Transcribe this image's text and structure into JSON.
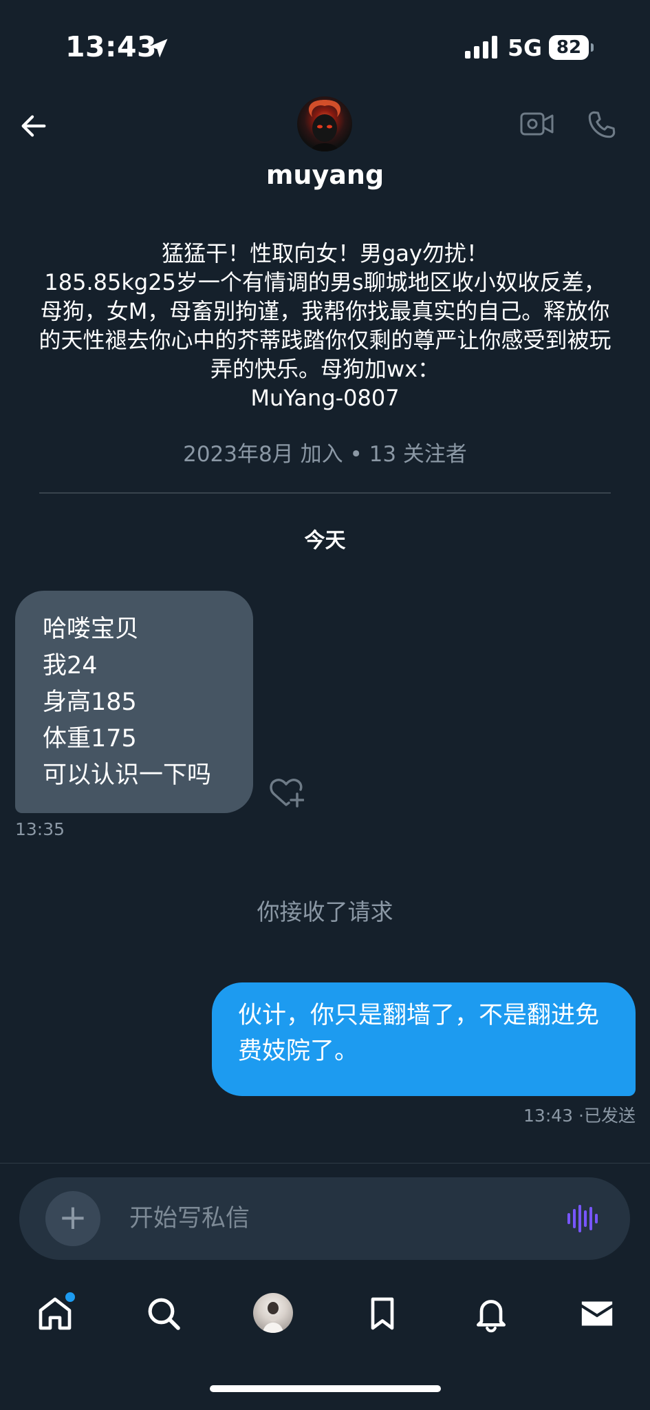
{
  "status_bar": {
    "time": "13:43",
    "network": "5G",
    "battery": "82"
  },
  "header": {
    "username": "muyang",
    "icons": [
      "back-arrow-icon",
      "video-call-icon",
      "phone-call-icon"
    ]
  },
  "profile": {
    "bio": "猛猛干！性取向女！男gay勿扰！\n185.85kg25岁一个有情调的男s聊城地区收小奴收反差，母狗，女M，母畜别拘谨，我帮你找最真实的自己。释放你的天性褪去你心中的芥蒂践踏你仅剩的尊严让你感受到被玩弄的快乐。母狗加wx：\nMuYang-0807",
    "joined": "2023年8月 加入",
    "separator": "•",
    "followers": "13 关注者"
  },
  "conversation": {
    "date_separator": "今天",
    "incoming": {
      "lines": [
        "哈喽宝贝",
        "我24",
        "身高185",
        "体重175",
        "可以认识一下吗"
      ],
      "time": "13:35"
    },
    "system_message": "你接收了请求",
    "outgoing": {
      "text": "伙计，你只是翻墙了，不是翻进免费妓院了。",
      "time": "13:43",
      "separator": "·",
      "status": "已发送"
    }
  },
  "composer": {
    "placeholder": "开始写私信",
    "plus_label": "+"
  },
  "tab_bar": {
    "items": [
      "home",
      "search",
      "profile",
      "bookmarks",
      "notifications",
      "messages"
    ],
    "accent_color": "#1d9bf0"
  },
  "colors": {
    "background": "#15202b",
    "incoming_bubble": "#465563",
    "outgoing_bubble": "#1d9bf0",
    "muted_text": "#8b98a5",
    "voice_icon": "#7856ff"
  }
}
